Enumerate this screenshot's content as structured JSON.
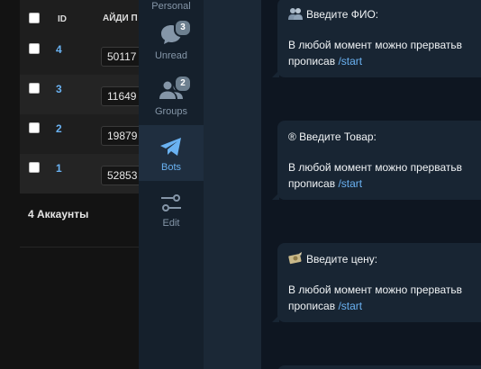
{
  "admin_table": {
    "header": {
      "id_label": "ID",
      "account_label": "АЙДИ П"
    },
    "rows": [
      {
        "id": "4",
        "account_value": "50117"
      },
      {
        "id": "3",
        "account_value": "11649"
      },
      {
        "id": "2",
        "account_value": "19879"
      },
      {
        "id": "1",
        "account_value": "52853"
      }
    ],
    "footer_count": "4 Аккаунты"
  },
  "folders": {
    "items": [
      {
        "label": "Personal",
        "icon": "person-icon"
      },
      {
        "label": "Unread",
        "icon": "chat-bubble-icon",
        "badge": "3"
      },
      {
        "label": "Groups",
        "icon": "group-icon",
        "badge": "2"
      },
      {
        "label": "Bots",
        "icon": "telegram-plane-icon",
        "active": true
      },
      {
        "label": "Edit",
        "icon": "sliders-icon"
      }
    ]
  },
  "messages": [
    {
      "emoji": "people-emoji",
      "title": "Введите ФИО:",
      "body": "В любой момент можно прерватьв",
      "body2_prefix": "прописав ",
      "command": "/start"
    },
    {
      "emoji": "registered-emoji",
      "title": "® Введите Товар:",
      "body": "В любой момент можно прерватьв",
      "body2_prefix": "прописав ",
      "command": "/start"
    },
    {
      "emoji": "money-emoji",
      "title": "Введите цену:",
      "body": "В любой момент можно прерватьв",
      "body2_prefix": "прописав ",
      "command": "/start"
    }
  ],
  "colors": {
    "accent": "#6ab2f2",
    "sidebar_bg": "#15202c",
    "chat_bg": "#0e1621",
    "bubble_bg": "#182533"
  }
}
